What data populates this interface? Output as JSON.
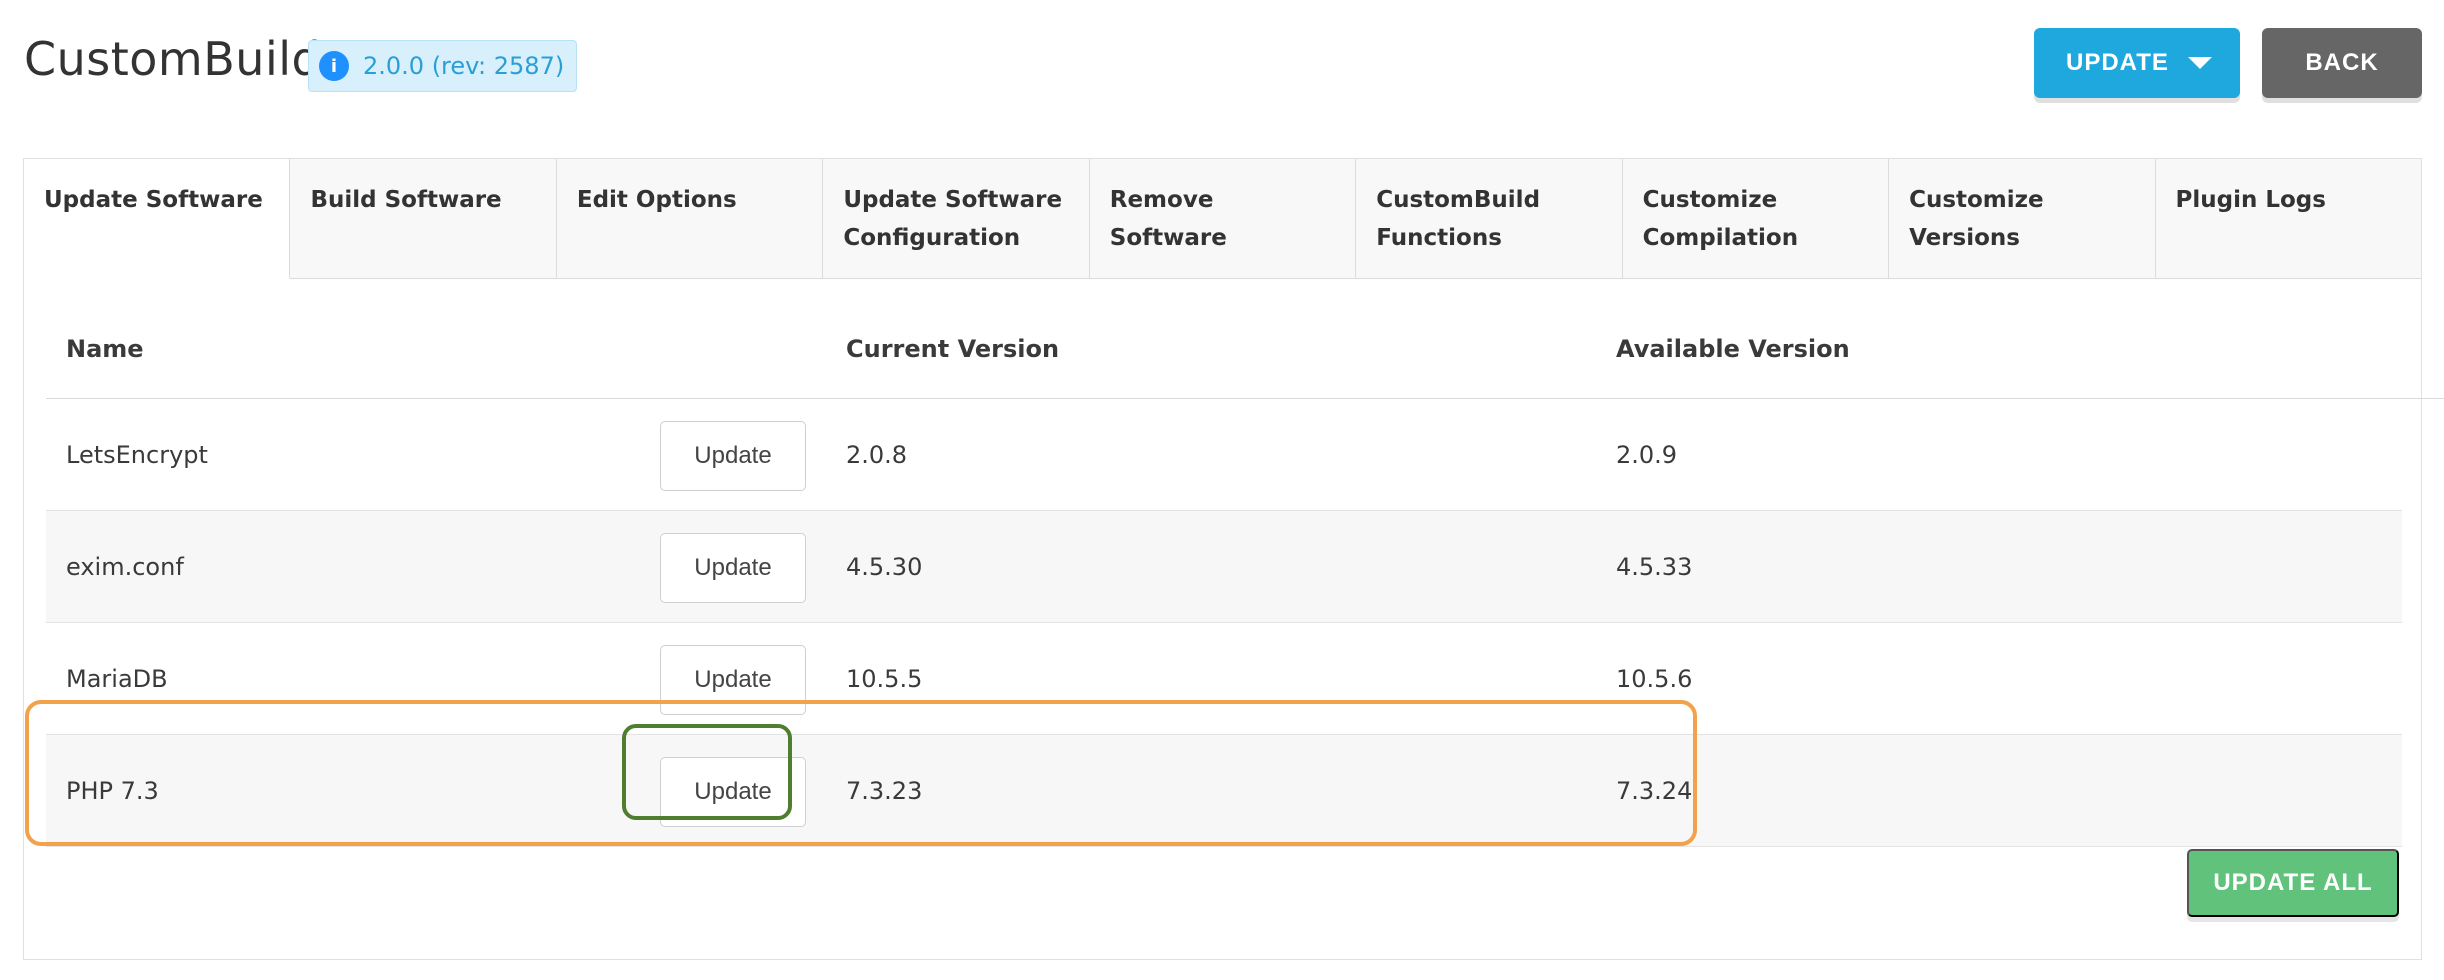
{
  "header": {
    "title": "CustomBuild",
    "version_badge": "2.0.0 (rev: 2587)",
    "update_button": "UPDATE",
    "back_button": "BACK"
  },
  "tabs": [
    {
      "label": "Update Software",
      "active": true
    },
    {
      "label": "Build Software"
    },
    {
      "label": "Edit Options"
    },
    {
      "label": "Update Software Configuration"
    },
    {
      "label": "Remove Software"
    },
    {
      "label": "CustomBuild Functions"
    },
    {
      "label": "Customize Compilation"
    },
    {
      "label": "Customize Versions"
    },
    {
      "label": "Plugin Logs"
    }
  ],
  "table": {
    "headers": {
      "name": "Name",
      "current": "Current Version",
      "available": "Available Version"
    },
    "update_label": "Update",
    "rows": [
      {
        "name": "LetsEncrypt",
        "current": "2.0.8",
        "available": "2.0.9"
      },
      {
        "name": "exim.conf",
        "current": "4.5.30",
        "available": "4.5.33"
      },
      {
        "name": "MariaDB",
        "current": "10.5.5",
        "available": "10.5.6"
      },
      {
        "name": "PHP 7.3",
        "current": "7.3.23",
        "available": "7.3.24"
      }
    ]
  },
  "footer": {
    "update_all": "UPDATE ALL"
  },
  "colors": {
    "primary": "#1ea8dd",
    "back": "#666666",
    "success": "#61c27c",
    "highlight_orange": "#f2a24a",
    "highlight_green": "#4f7f2e"
  }
}
